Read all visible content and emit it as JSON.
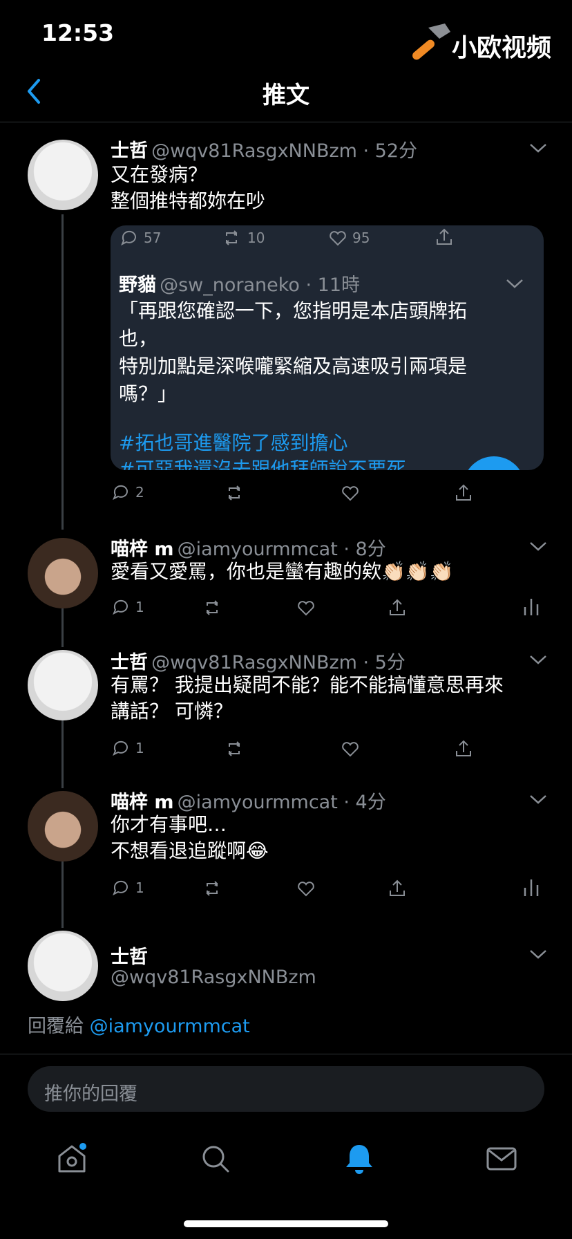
{
  "status": {
    "time": "12:53"
  },
  "watermark": {
    "text": "小欧视频",
    "icon": "hammer-icon"
  },
  "header": {
    "title": "推文",
    "back_icon": "chevron-left-icon"
  },
  "colors": {
    "accent": "#1d9bf0",
    "background": "#000000",
    "muted": "#8a8f96",
    "card": "#1f2733"
  },
  "tweets": [
    {
      "name": "士哲",
      "meta": "@wqv81RasgxNNBzm · 52分",
      "lines": [
        "又在發病？",
        "整個推特都妳在吵"
      ],
      "actions": {
        "reply": "2"
      }
    },
    {
      "name": "喵梓 m",
      "meta": "@iamyourmmcat · 8分",
      "lines": [
        "愛看又愛罵，你也是蠻有趣的欸👏🏻👏🏻👏🏻"
      ],
      "actions": {
        "reply": "1"
      }
    },
    {
      "name": "士哲",
      "meta": "@wqv81RasgxNNBzm · 5分",
      "lines": [
        "有罵？ 我提出疑問不能？能不能搞懂意思再來",
        "講話？ 可憐？"
      ],
      "actions": {
        "reply": "1"
      }
    },
    {
      "name": "喵梓 m",
      "meta": "@iamyourmmcat · 4分",
      "lines": [
        "你才有事吧…",
        "不想看退追蹤啊😂"
      ],
      "actions": {
        "reply": "1"
      }
    }
  ],
  "quote": {
    "top_actions": {
      "reply": "57",
      "retweet": "10",
      "like": "95"
    },
    "name": "野貓",
    "meta": "@sw_noraneko · 11時",
    "lines": [
      "「再跟您確認一下，您指明是本店頭牌拓",
      "也，",
      "特別加點是深喉嚨緊縮及高速吸引兩項是",
      "嗎？」"
    ],
    "hashtags": [
      "#拓也哥進醫院了感到擔心",
      "#可惡我還沒去跟他拜師說不要死"
    ]
  },
  "focused": {
    "name": "士哲",
    "handle": "@wqv81RasgxNNBzm",
    "reply_to_label": "回覆給",
    "reply_to_handle": "@iamyourmmcat"
  },
  "reply_input": {
    "placeholder": "推你的回覆"
  },
  "bottom_nav": [
    "home-icon",
    "search-icon",
    "notifications-icon",
    "messages-icon"
  ]
}
